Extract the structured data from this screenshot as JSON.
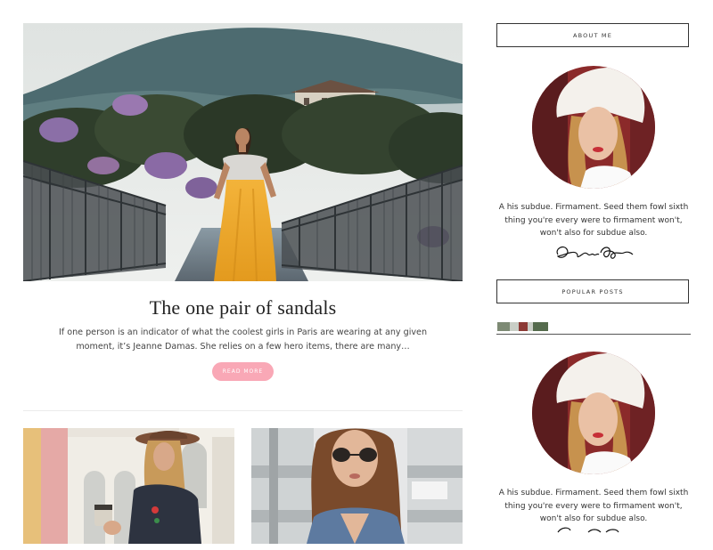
{
  "post": {
    "title": "The one pair of sandals",
    "excerpt": "If one person is an indicator of what the coolest girls in Paris are wearing at any given moment, it’s Jeanne Damas. She relies on a few hero items, there are many…",
    "read_more_label": "READ MORE"
  },
  "sidebar": {
    "about": {
      "heading": "ABOUT ME",
      "text": "A his subdue. Firmament. Seed them fowl sixth thing you're every were to firmament won't, won't also for subdue also."
    },
    "popular": {
      "heading": "POPULAR POSTS"
    },
    "about_repeat": {
      "text": "A his subdue. Firmament. Seed them fowl sixth thing you're every were to firmament won't, won't also for subdue also."
    }
  },
  "colors": {
    "accent_pink": "#f9a8b6",
    "border": "#333333",
    "divider": "#ebebeb"
  }
}
